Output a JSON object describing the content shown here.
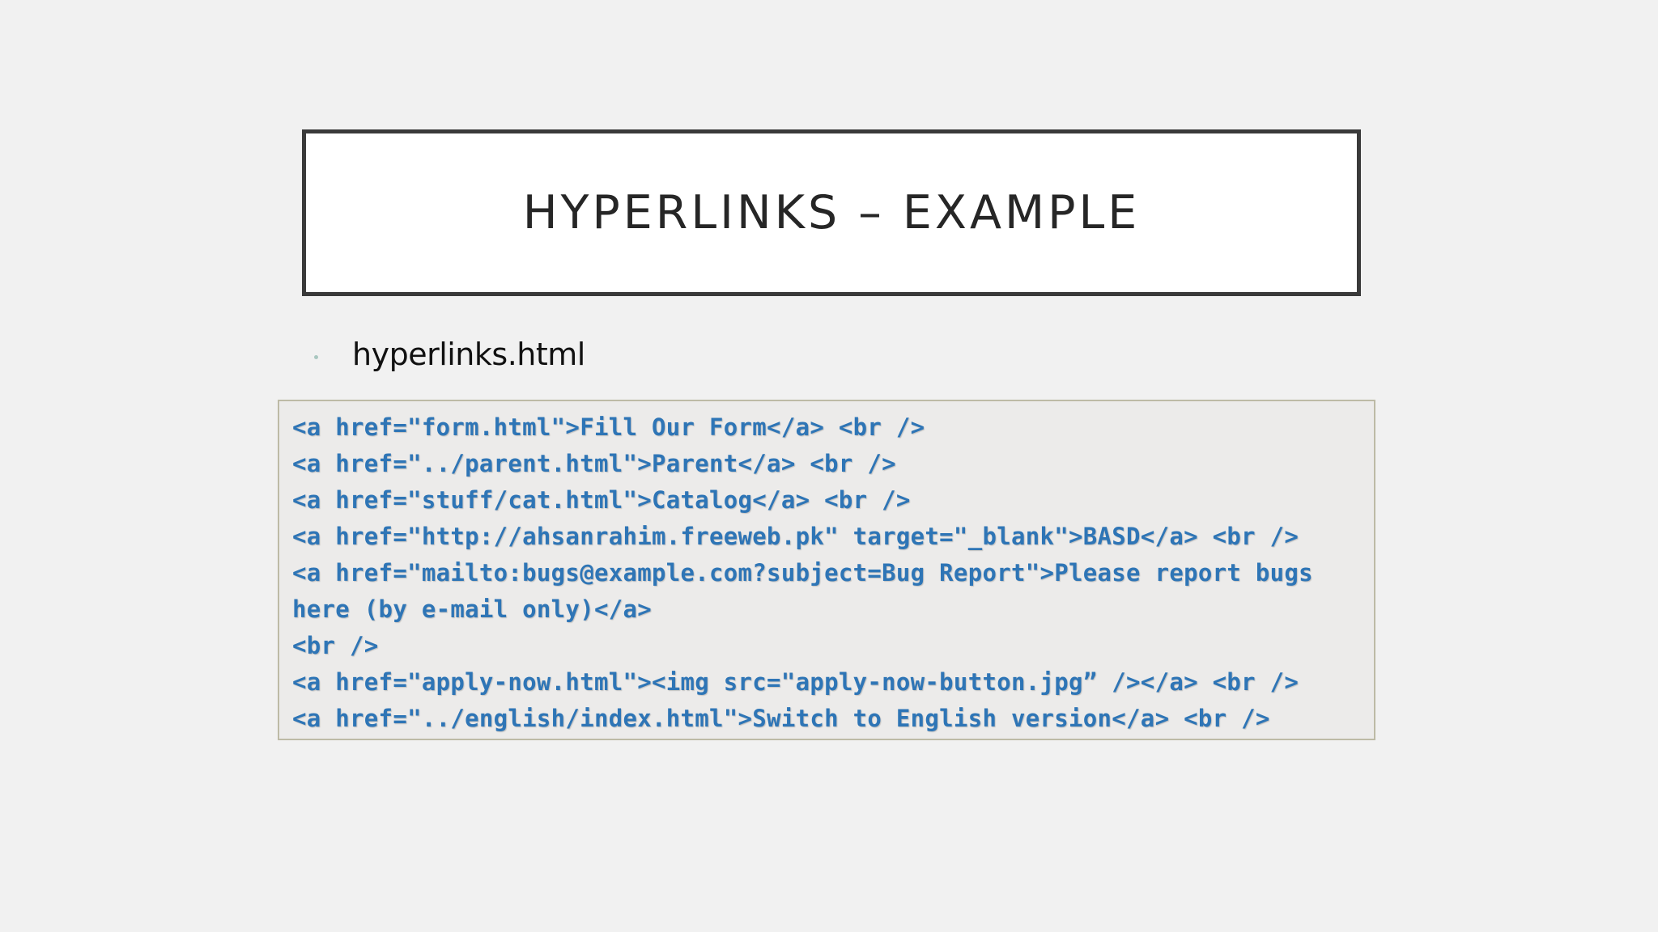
{
  "slide": {
    "title": "HYPERLINKS – EXAMPLE",
    "bullet": "hyperlinks.html",
    "code_lines": [
      "<a href=\"form.html\">Fill Our Form</a> <br />",
      "<a href=\"../parent.html\">Parent</a> <br />",
      "<a href=\"stuff/cat.html\">Catalog</a> <br />",
      "<a href=\"http://ahsanrahim.freeweb.pk\" target=\"_blank\">BASD</a> <br />",
      "<a href=\"mailto:bugs@example.com?subject=Bug Report\">Please report bugs",
      "here (by e-mail only)</a>",
      "<br />",
      "<a href=\"apply-now.html\"><img src=\"apply-now-button.jpg” /></a> <br />",
      "<a href=\"../english/index.html\">Switch to English version</a> <br />"
    ]
  },
  "colors": {
    "background": "#f1f1f1",
    "title_border": "#3a3a3a",
    "code_text": "#2e75b6",
    "code_background": "#ecebea",
    "bullet_dot": "#a9c7c0"
  }
}
